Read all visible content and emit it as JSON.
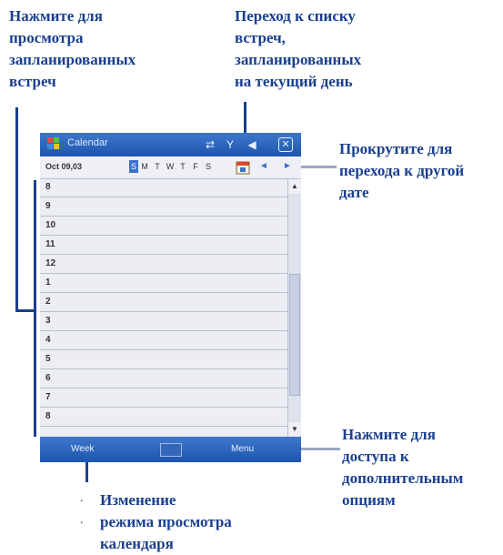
{
  "annotations": {
    "view_appointments": [
      "Нажмите  для",
      "просмотра",
      "запланированных",
      "встреч"
    ],
    "today_list": [
      "Переход к списку",
      "встреч,",
      "запланированных",
      "на текущий день"
    ],
    "scroll_date": [
      "Прокрутите для",
      "перехода к другой",
      "дате"
    ],
    "menu_options": [
      "Нажмите  для",
      "доступа к",
      "дополнительным",
      "опциям"
    ],
    "change_view": [
      "Изменение",
      "режима просмотра",
      "календаря"
    ]
  },
  "device": {
    "title": "Calendar",
    "date_label": "Oct 09,03",
    "days": [
      "S",
      "M",
      "T",
      "W",
      "T",
      "F",
      "S"
    ],
    "selected_day_index": 0,
    "hours": [
      "8",
      "9",
      "10",
      "11",
      "12",
      "1",
      "2",
      "3",
      "4",
      "5",
      "6",
      "7",
      "8"
    ],
    "softkeys": {
      "left": "Week",
      "right": "Menu"
    }
  },
  "colors": {
    "annotation": "#1a3f8f",
    "titlebar": "#2b63bd",
    "grid_bg": "#eceef3"
  }
}
